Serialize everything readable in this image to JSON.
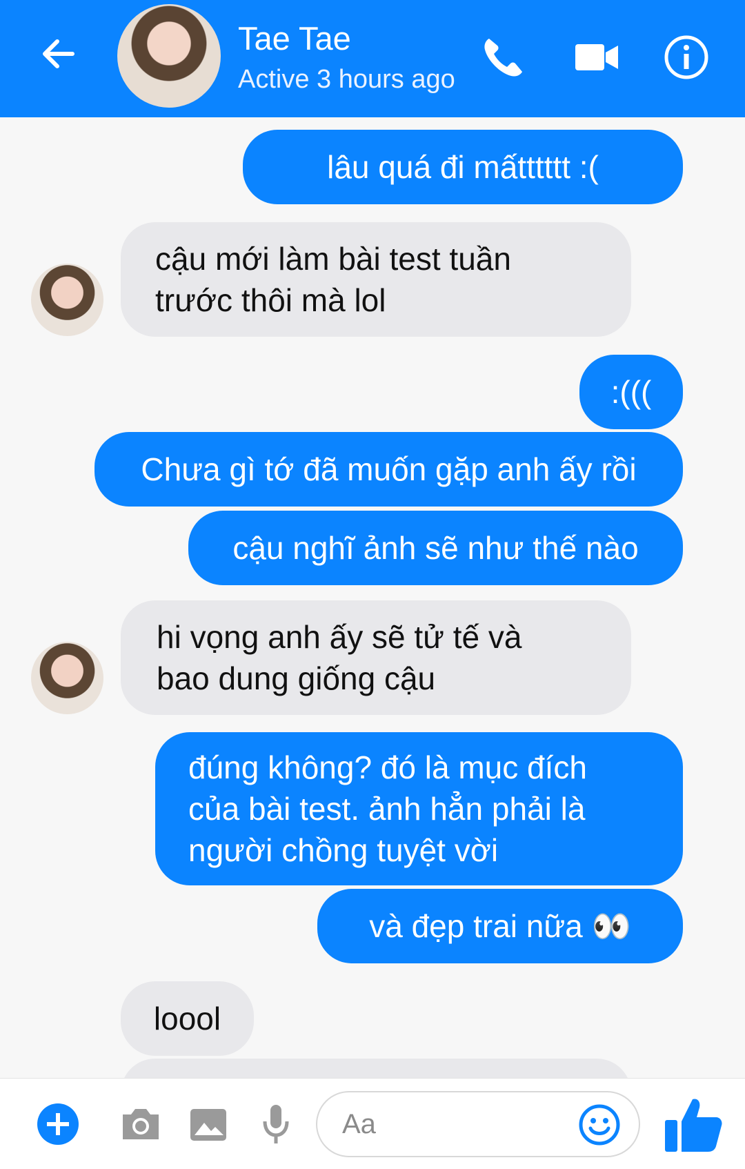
{
  "header": {
    "name": "Tae Tae",
    "status": "Active 3 hours ago"
  },
  "messages": [
    {
      "side": "out",
      "text": "lâu quá đi mấtttttt :("
    },
    {
      "side": "in",
      "lines": [
        "cậu mới làm bài test tuần",
        "trước thôi mà lol"
      ]
    },
    {
      "side": "out",
      "text": ":((("
    },
    {
      "side": "out",
      "text": "Chưa gì tớ đã muốn gặp anh ấy rồi"
    },
    {
      "side": "out",
      "text": "cậu nghĩ ảnh sẽ như thế nào"
    },
    {
      "side": "in",
      "lines": [
        "hi vọng anh ấy sẽ tử tế và",
        "bao dung giống cậu"
      ]
    },
    {
      "side": "out",
      "lines": [
        "đúng không? đó là mục đích",
        "của bài test. ảnh hẳn phải là",
        "người chồng tuyệt vời"
      ]
    },
    {
      "side": "out",
      "text": "và đẹp trai nữa 👀"
    },
    {
      "side": "in",
      "text": "loool"
    }
  ],
  "composer": {
    "placeholder": "Aa"
  },
  "colors": {
    "accent": "#0b84ff",
    "incoming_bubble": "#e8e8eb",
    "background": "#f7f7f7"
  },
  "icons": [
    "back-arrow-icon",
    "phone-icon",
    "video-camera-icon",
    "info-icon",
    "plus-icon",
    "camera-icon",
    "image-icon",
    "microphone-icon",
    "emoji-icon",
    "thumbs-up-icon"
  ]
}
